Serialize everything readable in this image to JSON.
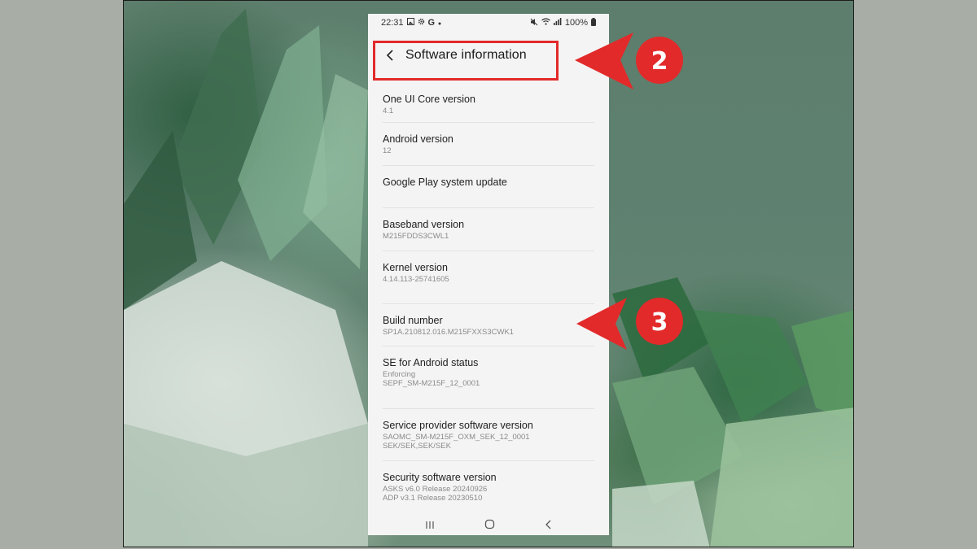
{
  "status_bar": {
    "time": "22:31",
    "left_icons": [
      "gallery-icon",
      "settings-gear-icon",
      "google-icon",
      "dot-icon"
    ],
    "right_icons": [
      "mute-icon",
      "wifi-icon",
      "signal-icon",
      "battery-icon"
    ],
    "battery": "100%"
  },
  "app_bar": {
    "title": "Software information",
    "back_icon": "chevron-left-icon"
  },
  "items": [
    {
      "label": "One UI Core version",
      "value": "4.1"
    },
    {
      "label": "Android version",
      "value": "12"
    },
    {
      "label": "Google Play system update",
      "value": ""
    },
    {
      "label": "Baseband version",
      "value": "M215FDDS3CWL1"
    },
    {
      "label": "Kernel version",
      "value": "4.14.113-25741605"
    },
    {
      "label": "Build number",
      "value": "SP1A.210812.016.M215FXXS3CWK1"
    },
    {
      "label": "SE for Android status",
      "value": "Enforcing\nSEPF_SM-M215F_12_0001"
    },
    {
      "label": "Service provider software version",
      "value": "SAOMC_SM-M215F_OXM_SEK_12_0001\nSEK/SEK,SEK/SEK"
    },
    {
      "label": "Security software version",
      "value": "ASKS v6.0 Release 20240926\nADP v3.1 Release 20230510"
    }
  ],
  "nav_bar": {
    "icons": [
      "recent-apps-icon",
      "home-icon",
      "back-icon"
    ]
  },
  "annotations": {
    "marker_2": "2",
    "marker_3": "3",
    "color": "#e22a2a"
  }
}
